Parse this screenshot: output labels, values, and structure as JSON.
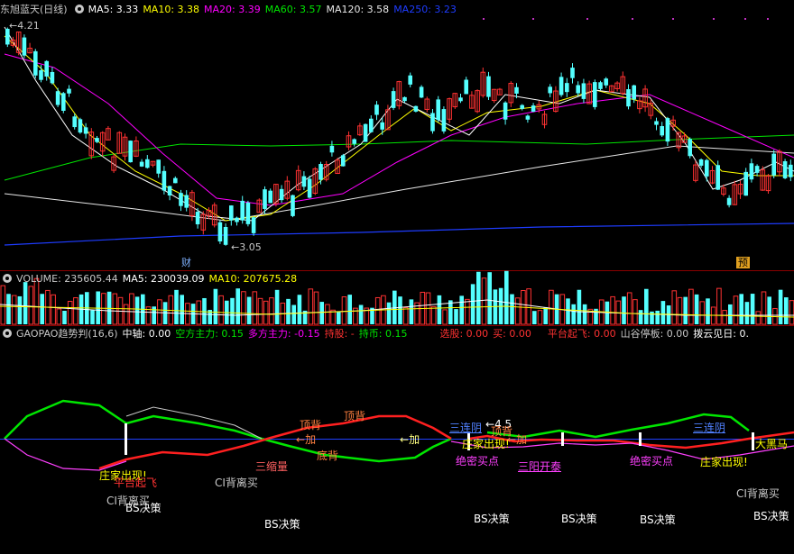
{
  "main_header": {
    "title": "东旭蓝天(日线)",
    "ma5": "MA5: 3.33",
    "ma10": "MA10: 3.38",
    "ma20": "MA20: 3.39",
    "ma60": "MA60: 3.57",
    "ma120": "MA120: 3.58",
    "ma250": "MA250: 3.23"
  },
  "price_annotations": {
    "high": "4.21",
    "low": "3.05",
    "badge_cai": "财",
    "badge_yu": "预"
  },
  "volume_header": {
    "volume": "VOLUME: 235605.44",
    "ma5": "MA5: 230039.09",
    "ma10": "MA10: 207675.28"
  },
  "indicator_header": {
    "name": "GAOPAO趋势判(16,6)",
    "zhongzhou": "中轴: 0.00",
    "kongfang": "空方主力: 0.15",
    "duofang": "多方主力: -0.15",
    "chigu": "持股: -",
    "chibi": "持币: 0.15",
    "xuangu": "选股: 0.00",
    "mai": "买: 0.00",
    "pingtai": "平台起飞: 0.00",
    "shangu": "山谷停板: 0.00",
    "boyun": "拨云见日: 0."
  },
  "indicator_signals": {
    "zhuangjia": "庄家出现!",
    "pingtaiqifei": "平台起飞",
    "cibeili": "CI背离买",
    "bsjuece": "BS决策",
    "sansuoliang": "三缩量",
    "dingbei": "顶背",
    "dibei": "底背",
    "jia": "加",
    "juemimaidian": "绝密买点",
    "sanyangkaitai": "三阳开泰",
    "dahei ma": "大黑马",
    "val45": "4.5",
    "sanlianyin": "三连阴"
  },
  "colors": {
    "up": "#ff3232",
    "down": "#54ffff",
    "ma5": "#ffffff",
    "ma10": "#ffff00",
    "ma20": "#ff00ff",
    "ma60": "#00e600",
    "ma120": "#e8e8e8",
    "ma250": "#1e3cff"
  }
}
